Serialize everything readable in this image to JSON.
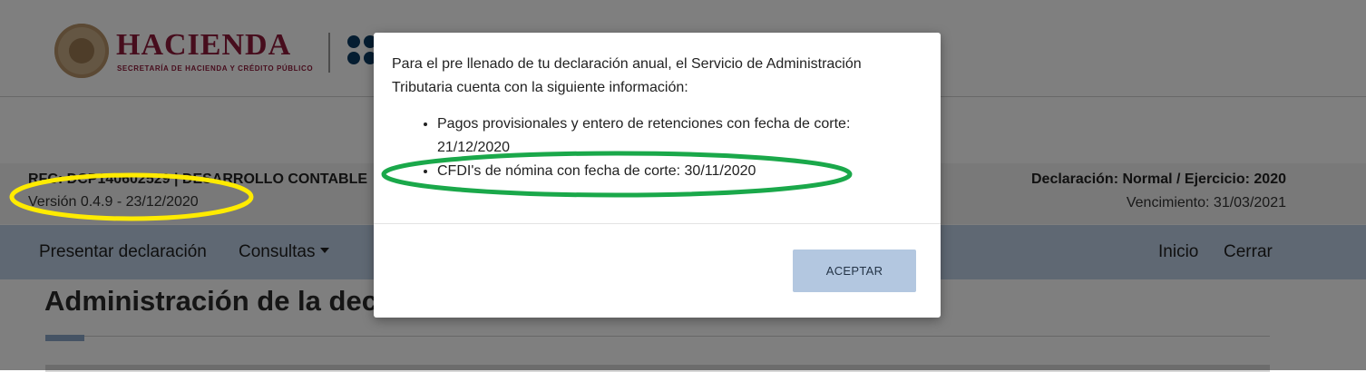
{
  "header": {
    "brand_name": "HACIENDA",
    "brand_subtitle": "SECRETARÍA DE HACIENDA Y CRÉDITO PÚBLICO"
  },
  "info_bar": {
    "rfc_line": "RFC: DCP140602529 | DESARROLLO CONTABLE",
    "version": "Versión 0.4.9 - 23/12/2020",
    "declaration": "Declaración: Normal / Ejercicio: 2020",
    "due_date": "Vencimiento: 31/03/2021"
  },
  "nav": {
    "present": "Presentar declaración",
    "queries": "Consultas",
    "home": "Inicio",
    "close": "Cerrar"
  },
  "page": {
    "title": "Administración de la declaración"
  },
  "modal": {
    "intro": "Para el pre llenado de tu declaración anual, el Servicio de Administración Tributaria cuenta con la siguiente información:",
    "items": [
      "Pagos provisionales y entero de retenciones con fecha de corte: 21/12/2020",
      "CFDI's de nómina con fecha de corte: 30/11/2020"
    ],
    "accept_label": "ACEPTAR"
  },
  "colors": {
    "brand": "#8e1b3a",
    "nav_background": "#bed0e6",
    "button_background": "#b3c7e0",
    "highlight_yellow": "#ffeb00",
    "highlight_green": "#1aa84a"
  },
  "icons": {
    "seal": "mexico-coat-of-arms-icon",
    "sat": "sat-logo-icon",
    "dropdown": "caret-down-icon"
  }
}
